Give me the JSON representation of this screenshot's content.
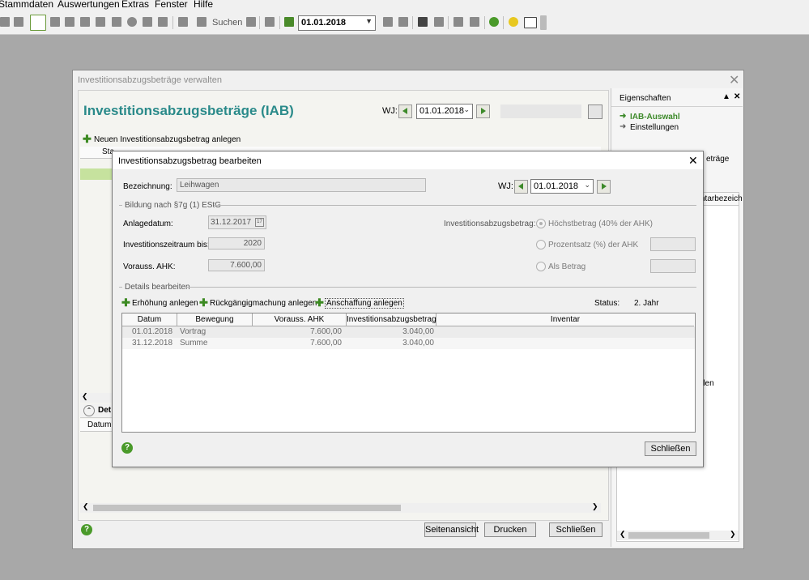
{
  "menu": [
    "Stammdaten",
    "Auswertungen",
    "Extras",
    "Fenster",
    "Hilfe"
  ],
  "toolbar": {
    "search_label": "Suchen",
    "date": "01.01.2018"
  },
  "main": {
    "window_title": "Investitionsabzugsbeträge verwalten",
    "heading": "Investitionsabzugsbeträge (IAB)",
    "wj_label": "WJ:",
    "wj_value": "01.01.2018",
    "new_link": "Neuen Investitionsabzugsbetrag anlegen",
    "grid_partial_header": "Sta",
    "details_partial": "Det",
    "details_col_partial": "Datum (",
    "buttons": {
      "preview": "Seitenansicht",
      "print": "Drucken",
      "close": "Schließen"
    }
  },
  "props": {
    "title": "Eigenschaften",
    "item_iab": "IAB-Auswahl",
    "item_settings": "Einstellungen",
    "partial1": "eträge",
    "partial2": "ntarbezeich",
    "partial3": "den"
  },
  "dialog": {
    "title": "Investitionsabzugsbetrag bearbeiten",
    "bezeichnung_label": "Bezeichnung:",
    "bezeichnung_value": "Leihwagen",
    "wj_label": "WJ:",
    "wj_value": "01.01.2018",
    "group1": "Bildung nach §7g (1) EStG",
    "anlagedatum_label": "Anlagedatum:",
    "anlagedatum_value": "31.12.2017",
    "zeitraum_label": "Investitionszeitraum bis:",
    "zeitraum_value": "2020",
    "ahk_label": "Vorauss. AHK:",
    "ahk_value": "7.600,00",
    "iab_label": "Investitionsabzugsbetrag:",
    "radio1": "Höchstbetrag (40% der AHK)",
    "radio2": "Prozentsatz (%) der AHK",
    "radio3": "Als Betrag",
    "group2": "Details bearbeiten",
    "action1": "Erhöhung anlegen",
    "action2": "Rückgängigmachung anlegen",
    "action3": "Anschaffung anlegen",
    "status_label": "Status:",
    "status_value": "2. Jahr",
    "columns": [
      "Datum",
      "Bewegung",
      "Vorauss. AHK",
      "Investitionsabzugsbetrag",
      "Inventar"
    ],
    "rows": [
      [
        "01.01.2018",
        "Vortrag",
        "7.600,00",
        "3.040,00",
        ""
      ],
      [
        "31.12.2018",
        "Summe",
        "7.600,00",
        "3.040,00",
        ""
      ]
    ],
    "close_button": "Schließen"
  }
}
